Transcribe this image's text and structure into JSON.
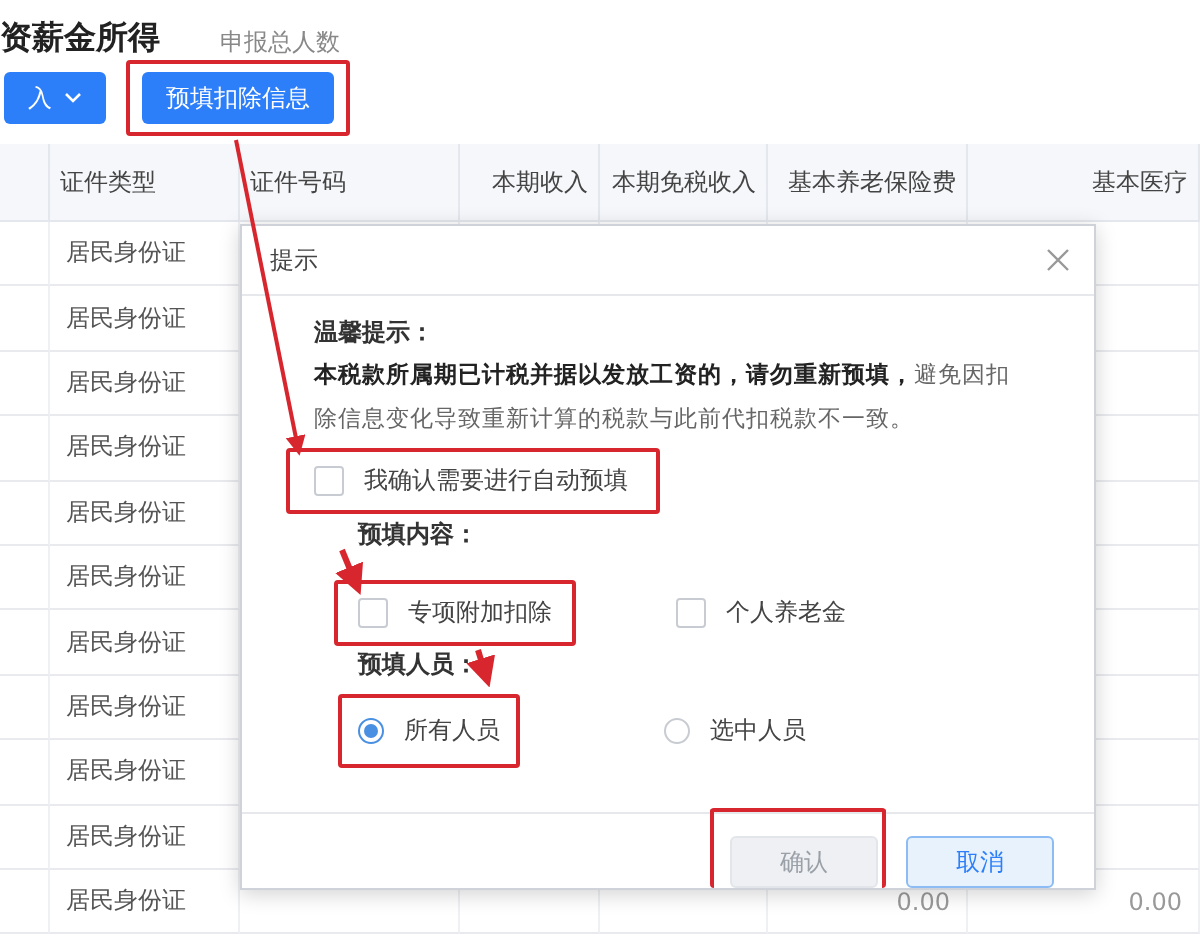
{
  "page": {
    "title": "资薪金所得",
    "count_label": "申报总人数"
  },
  "toolbar": {
    "buttons": [
      {
        "label": "入",
        "kind": "dropdown",
        "highlighted": false
      },
      {
        "label": "预填扣除信息",
        "kind": "plain",
        "highlighted": true
      }
    ]
  },
  "table": {
    "columns": [
      "证件类型",
      "证件号码",
      "本期收入",
      "本期免税收入",
      "基本养老保险费",
      "基本医疗"
    ],
    "rows": [
      {
        "id_type": "居民身份证"
      },
      {
        "id_type": "居民身份证"
      },
      {
        "id_type": "居民身份证"
      },
      {
        "id_type": "居民身份证"
      },
      {
        "id_type": "居民身份证"
      },
      {
        "id_type": "居民身份证"
      },
      {
        "id_type": "居民身份证"
      },
      {
        "id_type": "居民身份证"
      },
      {
        "id_type": "居民身份证"
      },
      {
        "id_type": "居民身份证"
      },
      {
        "id_type": "居民身份证",
        "basic_pension": "0.00",
        "column_6": "0.00"
      }
    ]
  },
  "dialog": {
    "title": "提示",
    "notice_heading": "温馨提示：",
    "notice": "**本税款所属期已计税并据以发放工资的，请勿重新预填，**避免因扣除信息变化导致重新计算的税款与此前代扣税款不一致。",
    "confirm": {
      "label": "我确认需要进行自动预填",
      "checked": false,
      "highlighted": true
    },
    "content_label": "预填内容：",
    "content_options": [
      {
        "label": "专项附加扣除",
        "checked": false,
        "highlighted": true
      },
      {
        "label": "个人养老金",
        "checked": false,
        "highlighted": false
      }
    ],
    "people_label": "预填人员：",
    "people_options": [
      {
        "label": "所有人员",
        "selected": true,
        "highlighted": true
      },
      {
        "label": "选中人员",
        "selected": false,
        "highlighted": false
      }
    ],
    "buttons": [
      {
        "label": "确认",
        "kind": "primary",
        "disabled": true,
        "highlighted": true
      },
      {
        "label": "取消",
        "kind": "secondary",
        "disabled": false,
        "highlighted": false
      }
    ]
  }
}
